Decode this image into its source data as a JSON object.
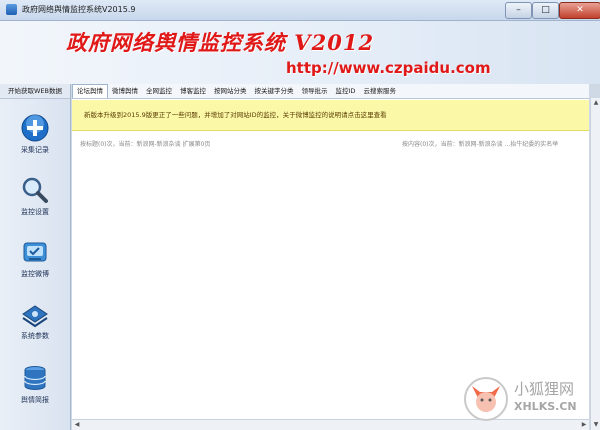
{
  "window": {
    "title": "政府网络舆情监控系统V2015.9",
    "minimize": "–",
    "maximize": "□",
    "close": "✕"
  },
  "banner": {
    "title": "政府网络舆情监控系统 V2012",
    "url": "http://www.czpaidu.com"
  },
  "sidebar": {
    "header": "开始获取WEB数据",
    "items": [
      {
        "label": "采集记录",
        "icon": "plus-circle-icon"
      },
      {
        "label": "监控设置",
        "icon": "magnifier-icon"
      },
      {
        "label": "监控微博",
        "icon": "weibo-icon"
      },
      {
        "label": "系统参数",
        "icon": "settings-icon"
      },
      {
        "label": "舆情简报",
        "icon": "database-icon"
      }
    ]
  },
  "tabs": [
    "论坛舆情",
    "微博舆情",
    "全网监控",
    "博客监控",
    "按网站分类",
    "按关键字分类",
    "领导批示",
    "监控ID",
    "云搜索服务"
  ],
  "active_tab": 0,
  "notice": "新版本升级到2015.9版更正了一些问题，并增加了对网站ID的监控，关于微博监控的说明请点击这里查看",
  "status": {
    "left": "按标题(0)次，当前：新浪网-新浪杂谈  扩展第0页",
    "right": "按内容(0)次，当前：新浪网-新浪杂谈 ...抬牛纪委的实名举"
  },
  "watermark": {
    "name": "小狐狸网",
    "domain": "XHLKS.CN"
  }
}
